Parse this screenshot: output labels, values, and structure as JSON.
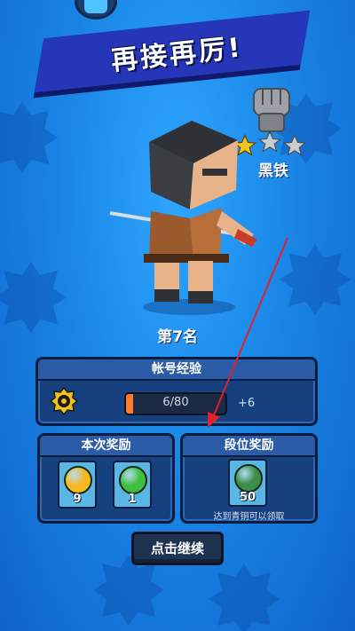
{
  "header": {
    "title": "再接再厉!"
  },
  "rank": {
    "name": "黑铁",
    "stars_earned": 1,
    "stars_total": 3
  },
  "result": {
    "place_text": "第7名"
  },
  "account_xp": {
    "title": "帐号经验",
    "progress_text": "6/80",
    "current": 6,
    "max": 80,
    "gain_text": "+6"
  },
  "this_reward": {
    "title": "本次奖励",
    "items": [
      {
        "icon": "gold-coin-icon",
        "count": "9",
        "color": "#f6b81e"
      },
      {
        "icon": "green-gem-icon",
        "count": "1",
        "color": "#3fbf3f"
      }
    ]
  },
  "tier_reward": {
    "title": "段位奖励",
    "item": {
      "icon": "planet-orb-icon",
      "count": "50",
      "color": "#3d8d4a"
    },
    "note": "达到青铜可以领取"
  },
  "continue_button": {
    "label": "点击继续"
  },
  "colors": {
    "banner": "#2536b8",
    "panel": "#16407e",
    "xp_fill": "#ff7a2a",
    "arrow": "#e0202a"
  }
}
